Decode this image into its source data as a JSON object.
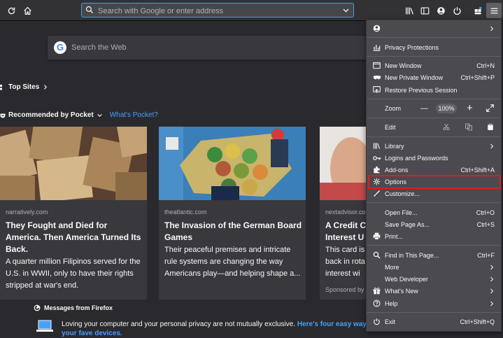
{
  "toolbar": {
    "url_placeholder": "Search with Google or enter address"
  },
  "newtab": {
    "search_placeholder": "Search the Web",
    "top_sites_label": "Top Sites",
    "pocket_label": "Recommended by Pocket",
    "whats_pocket_label": "What's Pocket?",
    "cards": [
      {
        "source": "narratively.com",
        "title": "They Fought and Died for America. Then America Turned Its Back.",
        "description": "A quarter million Filipinos served for the U.S. in WWII, only to have their rights stripped at war's end."
      },
      {
        "source": "theatlantic.com",
        "title": "The Invasion of the German Board Games",
        "description": "Their peaceful premises and intricate rule systems are changing the way Americans play—and helping shape a..."
      },
      {
        "source": "nextadvisor.co",
        "title": "A Credit C Interest U",
        "description": "This card is back in rota interest wi",
        "sponsored": "Sponsored by"
      }
    ],
    "messages_title": "Messages from Firefox",
    "messages_text": "Loving your computer and your personal privacy are not mutually exclusive. ",
    "messages_link": "Here's four easy way your fave devices."
  },
  "menu": {
    "privacy_protections": "Privacy Protections",
    "new_window": "New Window",
    "new_window_sc": "Ctrl+N",
    "new_private_window": "New Private Window",
    "new_private_window_sc": "Ctrl+Shift+P",
    "restore_session": "Restore Previous Session",
    "zoom": "Zoom",
    "zoom_minus": "—",
    "zoom_value": "100%",
    "zoom_plus": "+",
    "edit": "Edit",
    "library": "Library",
    "logins": "Logins and Passwords",
    "addons": "Add-ons",
    "addons_sc": "Ctrl+Shift+A",
    "options": "Options",
    "customize": "Customize...",
    "open_file": "Open File...",
    "open_file_sc": "Ctrl+O",
    "save_page": "Save Page As...",
    "save_page_sc": "Ctrl+S",
    "print": "Print...",
    "find": "Find in This Page...",
    "find_sc": "Ctrl+F",
    "more": "More",
    "web_developer": "Web Developer",
    "whats_new": "What's New",
    "help": "Help",
    "exit": "Exit",
    "exit_sc": "Ctrl+Shift+Q"
  }
}
